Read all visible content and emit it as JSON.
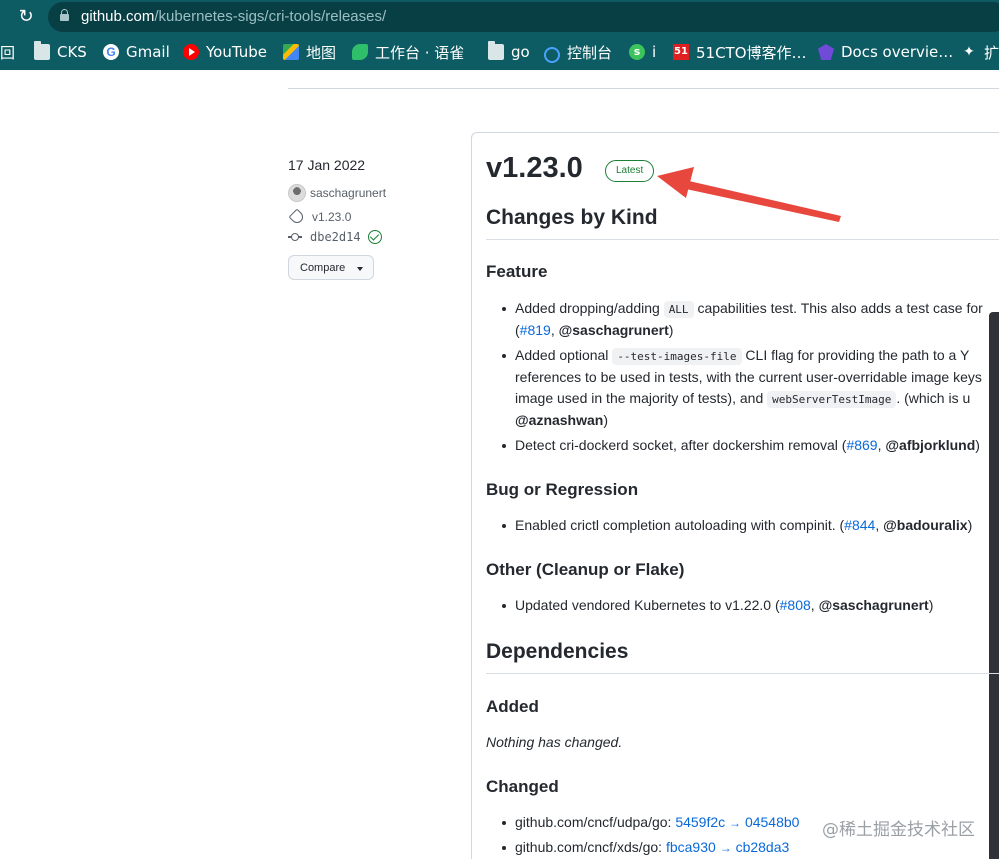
{
  "browser": {
    "url_host": "github.com",
    "url_path": "/kubernetes-sigs/cri-tools/releases/",
    "bookmarks": [
      {
        "label": "回",
        "icon": "apps-icon"
      },
      {
        "label": "CKS",
        "icon": "folder-icon"
      },
      {
        "label": "Gmail",
        "icon": "google-icon"
      },
      {
        "label": "YouTube",
        "icon": "youtube-icon"
      },
      {
        "label": "地图",
        "icon": "maps-icon"
      },
      {
        "label": "工作台 · 语雀",
        "icon": "yuque-icon"
      },
      {
        "label": "go",
        "icon": "folder-icon"
      },
      {
        "label": "控制台",
        "icon": "cloud-icon"
      },
      {
        "label": "i",
        "icon": "s-icon"
      },
      {
        "label": "51CTO博客作…",
        "icon": "51cto-icon"
      },
      {
        "label": "Docs overvie…",
        "icon": "docs-icon"
      },
      {
        "label": "扩",
        "icon": "extension-icon"
      }
    ]
  },
  "release": {
    "date": "17 Jan 2022",
    "author": "saschagrunert",
    "tag": "v1.23.0",
    "commit": "dbe2d14",
    "compare_label": "Compare",
    "version": "v1.23.0",
    "badge": "Latest"
  },
  "body": {
    "changes_by_kind": "Changes by Kind",
    "feature_heading": "Feature",
    "feature_1": {
      "pre": "Added dropping/adding ",
      "code": "ALL",
      "post": " capabilities test. This also adds a test case for",
      "pr": "#819",
      "user": "@saschagrunert"
    },
    "feature_2": {
      "pre": "Added optional ",
      "code": "--test-images-file",
      "post": " CLI flag for providing the path to a Y",
      "line2": "references to be used in tests, with the current user-overridable image keys",
      "line3_pre": "image used in the majority of tests), and ",
      "code2": "webServerTestImage",
      "line3_post": ". (which is u",
      "user": "@aznashwan"
    },
    "feature_3": {
      "pre": "Detect cri-dockerd socket, after dockershim removal (",
      "pr": "#869",
      "user": "@afbjorklund"
    },
    "bug_heading": "Bug or Regression",
    "bug_1": {
      "pre": "Enabled crictl completion autoloading with compinit. (",
      "pr": "#844",
      "user": "@badouralix"
    },
    "other_heading": "Other (Cleanup or Flake)",
    "other_1": {
      "pre": "Updated vendored Kubernetes to v1.22.0 (",
      "pr": "#808",
      "user": "@saschagrunert"
    },
    "dependencies": "Dependencies",
    "added_heading": "Added",
    "nothing_changed": "Nothing has changed.",
    "changed_heading": "Changed",
    "changed_1": {
      "pkg": "github.com/cncf/udpa/go: ",
      "from": "5459f2c",
      "to": "04548b0"
    },
    "changed_2": {
      "pkg": "github.com/cncf/xds/go: ",
      "from": "fbca930",
      "to": "cb28da3"
    }
  },
  "watermark": "@稀土掘金技术社区",
  "colors": {
    "chrome": "#0d5b63",
    "link": "#0969da",
    "latest": "#1a7f37",
    "annotation_arrow": "#e8473e"
  }
}
